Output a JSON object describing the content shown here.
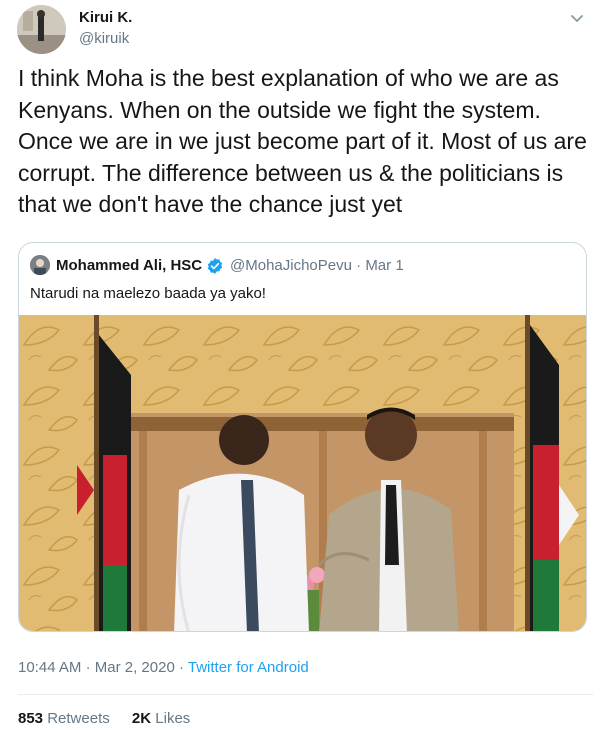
{
  "author": {
    "name": "Kirui K.",
    "handle": "@kiruik"
  },
  "tweet": {
    "text": "I think Moha is the best explanation of who we are as\nKenyans. When on the outside we fight the system.\nOnce we are in we just become part of it. Most of us are\ncorrupt. The difference between us & the politicians is\nthat we don't have the chance just yet",
    "time": "10:44 AM",
    "date": "Mar 2, 2020",
    "separator": "·",
    "source": "Twitter for Android"
  },
  "quoted": {
    "name": "Mohammed Ali, HSC",
    "handle": "@MohaJichoPevu",
    "separator": "·",
    "date": "Mar 1",
    "text": "Ntarudi na maelezo baada ya yako!"
  },
  "stats": {
    "retweets_count": "853",
    "retweets_label": "Retweets",
    "likes_count": "2K",
    "likes_label": "Likes"
  },
  "icons": {
    "caret": "chevron-down-icon",
    "verified": "verified-badge-icon"
  },
  "colors": {
    "accent": "#1da1f2",
    "secondary_text": "#657786",
    "border": "#ccd6dd"
  }
}
